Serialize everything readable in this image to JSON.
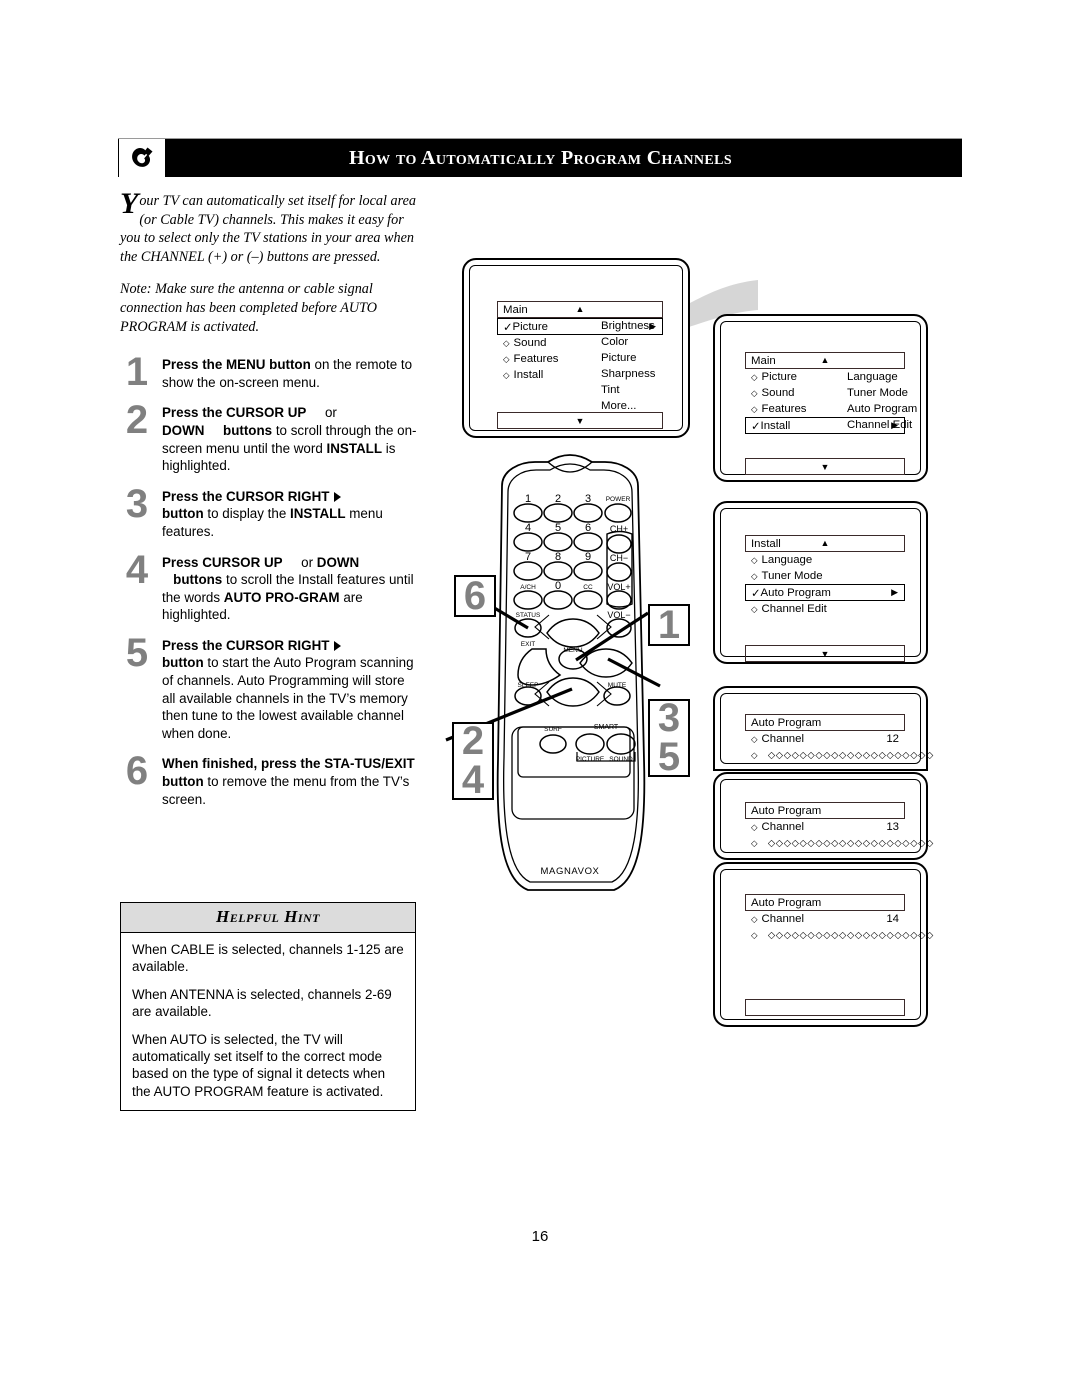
{
  "header": {
    "title": "How to Automatically Program Channels",
    "logo_icon": "magnavox-logo-icon"
  },
  "intro": {
    "dropcap": "Y",
    "text": "our TV can automatically set itself for local area (or Cable TV) channels. This makes it easy for you to select only the TV stations in your area when the CHANNEL (+) or (–) buttons are pressed.",
    "note": "Note: Make sure the antenna or cable signal connection has been completed before AUTO PROGRAM is activated."
  },
  "steps": [
    {
      "num": "1",
      "parts": [
        {
          "t": "Press the MENU button",
          "b": true
        },
        {
          "t": " on the remote to show the on-screen menu.",
          "b": false
        }
      ]
    },
    {
      "num": "2",
      "parts": [
        {
          "t": "Press the CURSOR UP",
          "b": true
        },
        {
          "t": "    or ",
          "b": false
        },
        {
          "t": "DOWN",
          "b": true
        },
        {
          "t": "     ",
          "b": false
        },
        {
          "t": "buttons",
          "b": true
        },
        {
          "t": " to scroll through the on-screen menu until the word ",
          "b": false
        },
        {
          "t": "INSTALL",
          "b": true
        },
        {
          "t": " is highlighted.",
          "b": false
        }
      ]
    },
    {
      "num": "3",
      "parts": [
        {
          "t": "Press the CURSOR RIGHT",
          "b": true
        },
        {
          "t": "▶",
          "b": true,
          "icon": "cursor-right-arrow-icon"
        },
        {
          "t": "button",
          "b": true
        },
        {
          "t": " to display the ",
          "b": false
        },
        {
          "t": "INSTALL",
          "b": true
        },
        {
          "t": " menu features.",
          "b": false
        }
      ]
    },
    {
      "num": "4",
      "parts": [
        {
          "t": "Press CURSOR UP",
          "b": true
        },
        {
          "t": "    or ",
          "b": false
        },
        {
          "t": "DOWN",
          "b": true
        },
        {
          "t": "   ",
          "b": false
        },
        {
          "t": "buttons",
          "b": true
        },
        {
          "t": " to scroll the Install features until the words ",
          "b": false
        },
        {
          "t": "AUTO PRO-GRAM",
          "b": true
        },
        {
          "t": " are highlighted.",
          "b": false
        }
      ]
    },
    {
      "num": "5",
      "parts": [
        {
          "t": "Press the CURSOR RIGHT",
          "b": true
        },
        {
          "t": "▶",
          "b": true,
          "icon": "cursor-right-arrow-icon"
        },
        {
          "t": "button",
          "b": true
        },
        {
          "t": " to start the Auto Program scanning of channels. Auto Programming will store all available channels in the TV’s memory then tune to the lowest available channel when done.",
          "b": false
        }
      ]
    },
    {
      "num": "6",
      "parts": [
        {
          "t": "When finished, press the STA-TUS/EXIT button",
          "b": true
        },
        {
          "t": " to remove the menu from the TV’s screen.",
          "b": false
        }
      ]
    }
  ],
  "hint": {
    "title": "Helpful Hint",
    "paragraphs": [
      "When CABLE is selected, channels 1-125 are available.",
      "When ANTENNA is selected, channels 2-69 are available.",
      "When AUTO is selected, the TV will automatically set itself to the correct mode based on the type of signal it detects when the AUTO PROGRAM feature is activated."
    ]
  },
  "osd": {
    "screen1": {
      "bar_title": "Main",
      "up_arrow": "▲",
      "down_arrow": "▼",
      "selected": "Picture",
      "left_items": [
        "Sound",
        "Features",
        "Install"
      ],
      "right_items": [
        "Brightness",
        "Color",
        "Picture",
        "Sharpness",
        "Tint",
        "More..."
      ]
    },
    "screen2": {
      "bar_title": "Main",
      "up_arrow": "▲",
      "down_arrow": "▼",
      "left_items": [
        "Picture",
        "Sound",
        "Features"
      ],
      "selected": "Install",
      "right_items": [
        "Language",
        "Tuner Mode",
        "Auto Program",
        "Channel Edit"
      ]
    },
    "screen3": {
      "bar_title": "Install",
      "up_arrow": "▲",
      "down_arrow": "▼",
      "items_before": [
        "Language",
        "Tuner Mode"
      ],
      "selected": "Auto Program",
      "items_after": [
        "Channel Edit"
      ]
    },
    "screen4": {
      "bar_title": "Auto Program",
      "row_label": "Channel",
      "row_value": "12",
      "dots": "◇◇◇◇◇◇◇◇◇◇◇◇◇◇◇◇◇◇◇◇◇"
    },
    "screen5": {
      "bar_title": "Auto Program",
      "row_label": "Channel",
      "row_value": "13",
      "dots": "◇◇◇◇◇◇◇◇◇◇◇◇◇◇◇◇◇◇◇◇◇"
    },
    "screen6": {
      "bar_title": "Auto Program",
      "row_label": "Channel",
      "row_value": "14",
      "dots": "◇◇◇◇◇◇◇◇◇◇◇◇◇◇◇◇◇◇◇◇◇"
    }
  },
  "remote": {
    "brand": "MAGNAVOX",
    "keys": {
      "k1": "1",
      "k2": "2",
      "k3": "3",
      "power": "POWER",
      "k4": "4",
      "k5": "5",
      "k6": "6",
      "chplus": "CH+",
      "k7": "7",
      "k8": "8",
      "k9": "9",
      "chminus": "CH−",
      "ach": "A/CH",
      "k0": "0",
      "cc": "CC",
      "volplus": "VOL+",
      "status": "STATUS",
      "exit": "EXIT",
      "volminus": "VOL−",
      "menu": "MENU",
      "sleep": "SLEEP",
      "mute": "MUTE",
      "surf": "SURF",
      "smart": "SMART",
      "picture": "PICTURE",
      "sound": "SOUND"
    }
  },
  "callouts": {
    "c6": "6",
    "c1": "1",
    "c3": "3",
    "c5": "5",
    "c2": "2",
    "c4": "4"
  },
  "footer": {
    "page_number": "16"
  }
}
